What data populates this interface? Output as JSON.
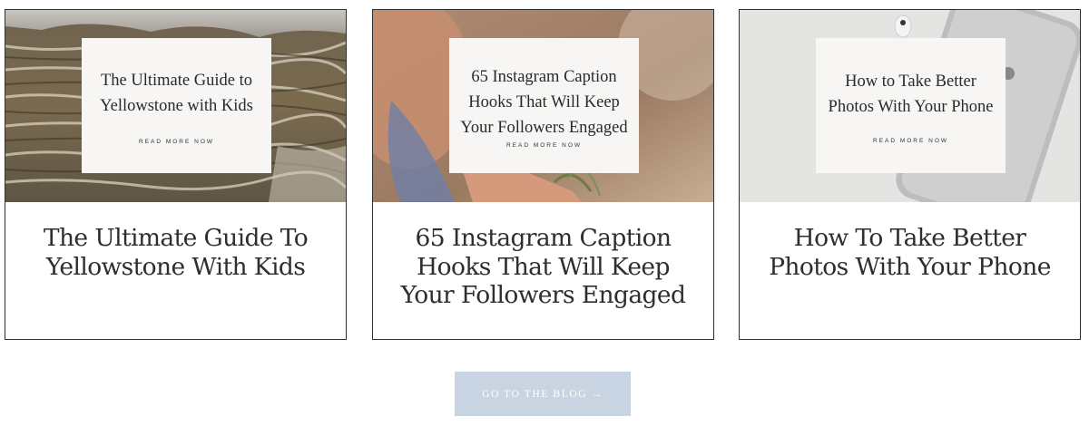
{
  "posts": [
    {
      "overlay_title": "The Ultimate Guide to Yellowstone with Kids",
      "overlay_cta": "READ MORE NOW",
      "title": "The Ultimate Guide To Yellowstone With Kids",
      "image": "yellowstone-terraces"
    },
    {
      "overlay_title": "65 Instagram Caption Hooks That Will Keep Your Followers Engaged",
      "overlay_cta": "READ MORE NOW",
      "title": "65 Instagram Caption Hooks That Will Keep Your Followers Engaged",
      "image": "hand-holding-flowers"
    },
    {
      "overlay_title": "How to Take Better Photos With Your Phone",
      "overlay_cta": "READ MORE NOW",
      "title": "How To Take Better Photos With Your Phone",
      "image": "iphone-and-earbuds"
    }
  ],
  "blog_button": {
    "label": "GO TO THE BLOG →"
  },
  "colors": {
    "button_bg": "#c9d4e3",
    "card_border": "#2f2f2f",
    "overlay_bg": "#f7f6f4"
  }
}
